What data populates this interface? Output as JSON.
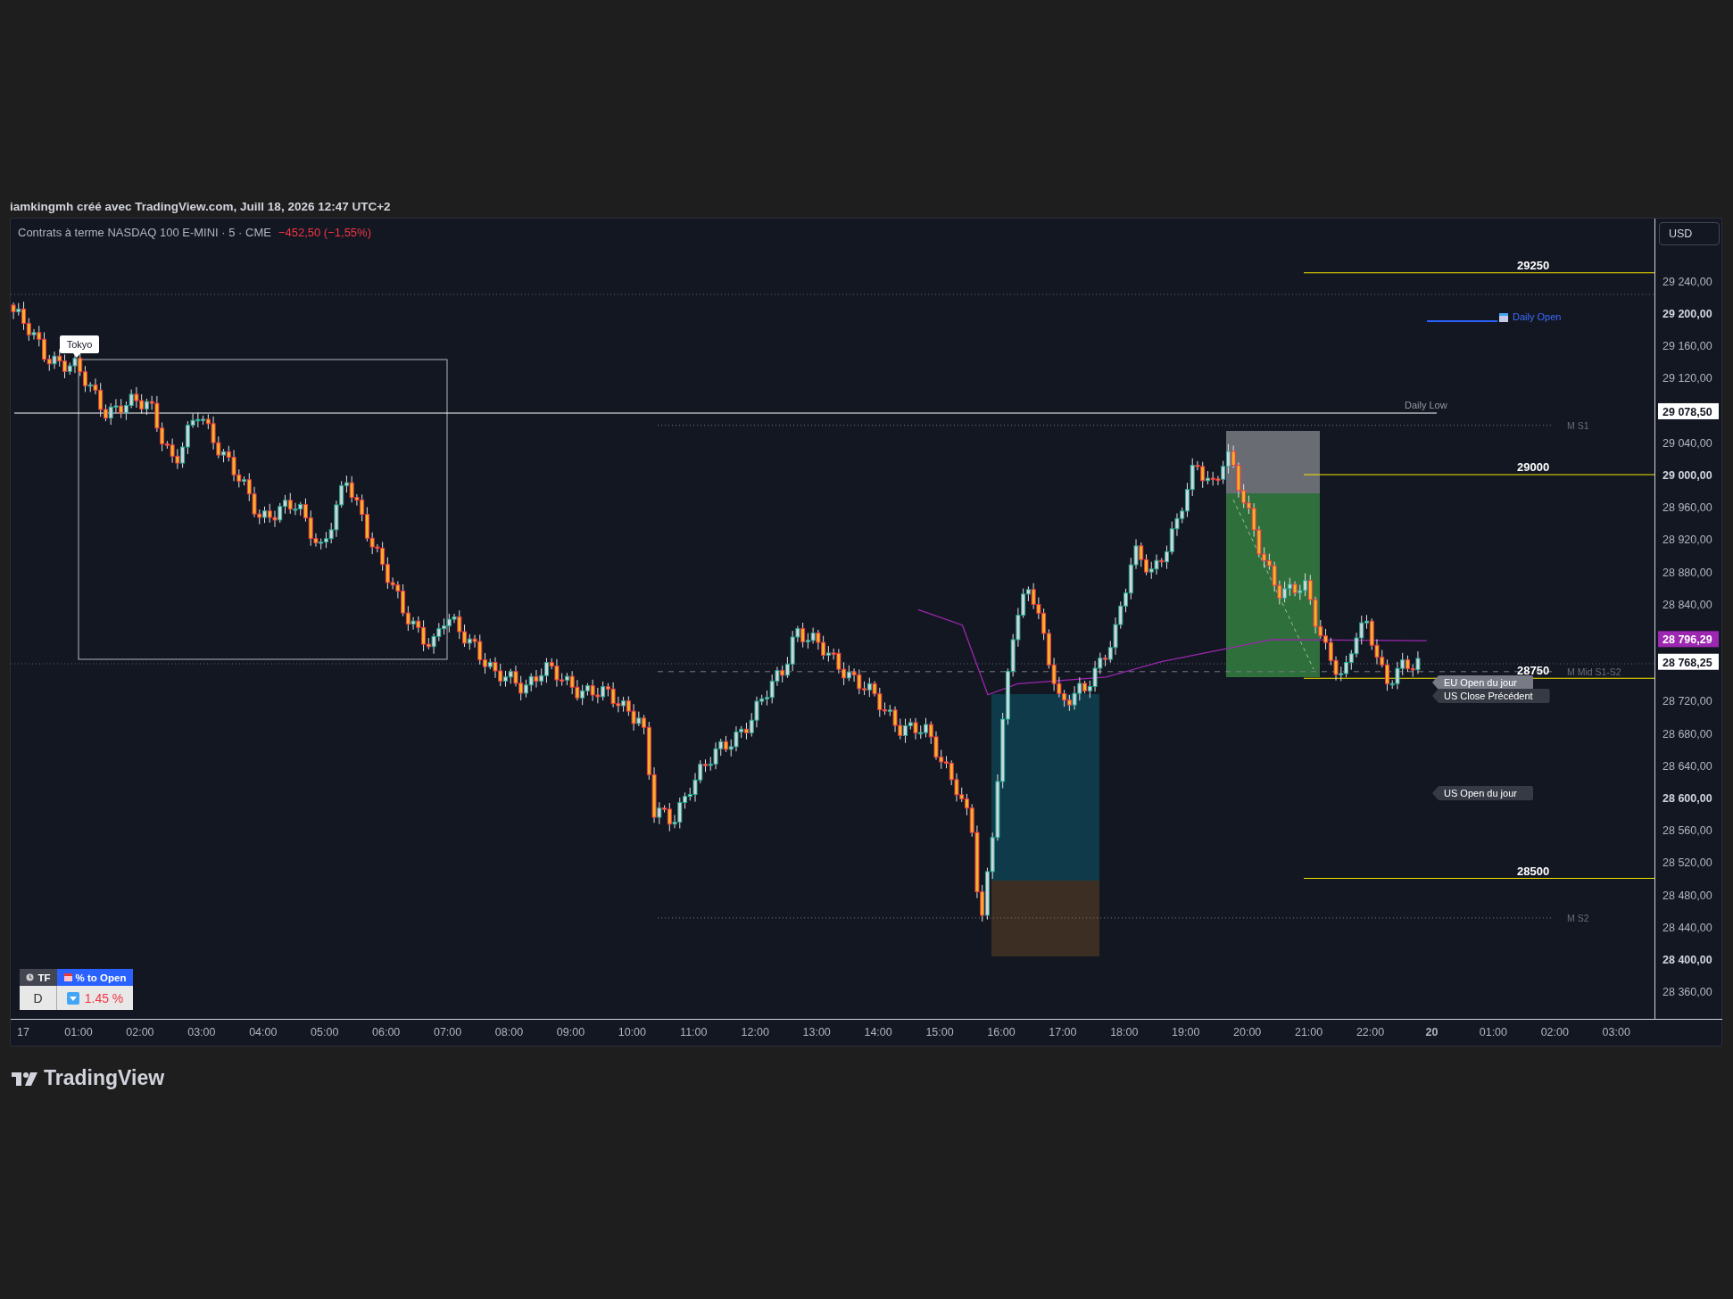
{
  "header": {
    "author_line": "iamkingmh créé avec TradingView.com, Juill 18, 2026 12:47 UTC+2"
  },
  "legend": {
    "symbol": "Contrats à terme NASDAQ 100 E-MINI · 5 · CME",
    "change": "−452,50 (−1,55%)"
  },
  "currency_button": "USD",
  "price_ticks": [
    {
      "label": "29 240,00",
      "bold": false
    },
    {
      "label": "29 200,00",
      "bold": true
    },
    {
      "label": "29 160,00",
      "bold": false
    },
    {
      "label": "29 120,00",
      "bold": false
    },
    {
      "label": "29 040,00",
      "bold": false
    },
    {
      "label": "29 000,00",
      "bold": true
    },
    {
      "label": "28 960,00",
      "bold": false
    },
    {
      "label": "28 920,00",
      "bold": false
    },
    {
      "label": "28 880,00",
      "bold": false
    },
    {
      "label": "28 840,00",
      "bold": false
    },
    {
      "label": "28 720,00",
      "bold": false
    },
    {
      "label": "28 680,00",
      "bold": false
    },
    {
      "label": "28 640,00",
      "bold": false
    },
    {
      "label": "28 600,00",
      "bold": true
    },
    {
      "label": "28 560,00",
      "bold": false
    },
    {
      "label": "28 520,00",
      "bold": false
    },
    {
      "label": "28 480,00",
      "bold": false
    },
    {
      "label": "28 440,00",
      "bold": false
    },
    {
      "label": "28 400,00",
      "bold": true
    },
    {
      "label": "28 360,00",
      "bold": false
    }
  ],
  "price_tags": [
    {
      "label": "29 078,50",
      "color": "#ffffff"
    },
    {
      "label": "28 796,29",
      "color": "#9c27b0"
    },
    {
      "label": "28 768,25",
      "color": "#ffffff"
    }
  ],
  "time_ticks": [
    {
      "label": "17",
      "bold": false
    },
    {
      "label": "01:00",
      "bold": false
    },
    {
      "label": "02:00",
      "bold": false
    },
    {
      "label": "03:00",
      "bold": false
    },
    {
      "label": "04:00",
      "bold": false
    },
    {
      "label": "05:00",
      "bold": false
    },
    {
      "label": "06:00",
      "bold": false
    },
    {
      "label": "07:00",
      "bold": false
    },
    {
      "label": "08:00",
      "bold": false
    },
    {
      "label": "09:00",
      "bold": false
    },
    {
      "label": "10:00",
      "bold": false
    },
    {
      "label": "11:00",
      "bold": false
    },
    {
      "label": "12:00",
      "bold": false
    },
    {
      "label": "13:00",
      "bold": false
    },
    {
      "label": "14:00",
      "bold": false
    },
    {
      "label": "15:00",
      "bold": false
    },
    {
      "label": "16:00",
      "bold": false
    },
    {
      "label": "17:00",
      "bold": false
    },
    {
      "label": "18:00",
      "bold": false
    },
    {
      "label": "19:00",
      "bold": false
    },
    {
      "label": "20:00",
      "bold": false
    },
    {
      "label": "21:00",
      "bold": false
    },
    {
      "label": "22:00",
      "bold": false
    },
    {
      "label": "20",
      "bold": true
    },
    {
      "label": "01:00",
      "bold": false
    },
    {
      "label": "02:00",
      "bold": false
    },
    {
      "label": "03:00",
      "bold": false
    }
  ],
  "levels": [
    {
      "label": "29250"
    },
    {
      "label": "29000"
    },
    {
      "label": "28750"
    },
    {
      "label": "28500"
    }
  ],
  "daily_open": "Daily Open",
  "daily_low": "Daily Low",
  "pivots": [
    {
      "label": "M S1"
    },
    {
      "label": "M Mid S1-S2"
    },
    {
      "label": "M S2"
    }
  ],
  "session_box": "Tokyo",
  "session_tags": [
    {
      "label": "EU Open du jour",
      "color": "#787b86"
    },
    {
      "label": "US Close Précédent",
      "color": "#363a45"
    },
    {
      "label": "US Open du jour",
      "color": "#363a45"
    }
  ],
  "table": {
    "headers": [
      "TF",
      "% to Open"
    ],
    "cells": [
      "D",
      "1.45 %"
    ]
  },
  "footer_logo": "TradingView"
}
